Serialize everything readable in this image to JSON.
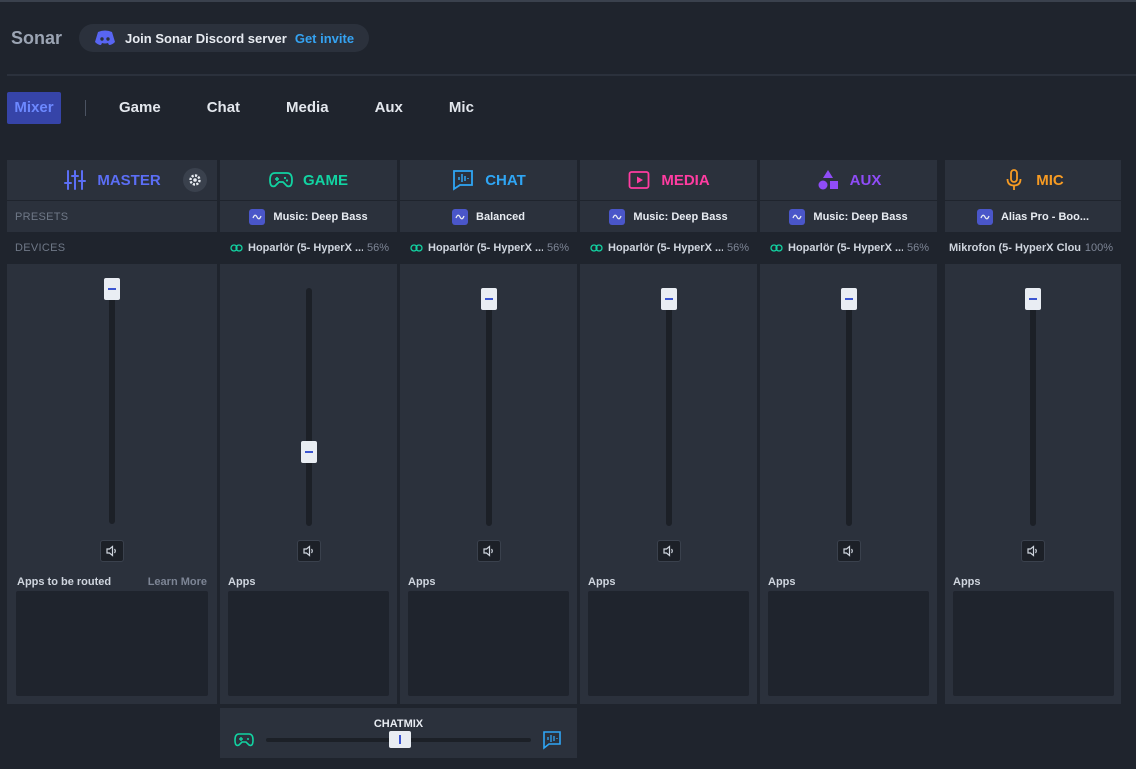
{
  "app": {
    "title": "Sonar",
    "discord_text": "Join Sonar Discord server",
    "discord_link": "Get invite"
  },
  "tabs": [
    "Mixer",
    "Game",
    "Chat",
    "Media",
    "Aux",
    "Mic"
  ],
  "labels": {
    "presets": "PRESETS",
    "devices": "DEVICES"
  },
  "master": {
    "title": "MASTER",
    "color": "#5b6ef5",
    "volume": 1.0,
    "apps_label": "Apps to be routed",
    "learn_more": "Learn More"
  },
  "channels": [
    {
      "key": "game",
      "title": "GAME",
      "color": "#12d3a2",
      "icon": "gamepad-icon",
      "preset": "Music: Deep Bass",
      "device": "Hoparlör (5- HyperX ...",
      "percent": "56%",
      "volume": 0.3,
      "apps_label": "Apps"
    },
    {
      "key": "chat",
      "title": "CHAT",
      "color": "#2fa6f5",
      "icon": "chat-wave-icon",
      "preset": "Balanced",
      "device": "Hoparlör (5- HyperX ...",
      "percent": "56%",
      "volume": 1.0,
      "apps_label": "Apps"
    },
    {
      "key": "media",
      "title": "MEDIA",
      "color": "#ff3ca1",
      "icon": "play-icon",
      "preset": "Music: Deep Bass",
      "device": "Hoparlör (5- HyperX ...",
      "percent": "56%",
      "volume": 1.0,
      "apps_label": "Apps"
    },
    {
      "key": "aux",
      "title": "AUX",
      "color": "#8f4cf7",
      "icon": "shapes-icon",
      "preset": "Music: Deep Bass",
      "device": "Hoparlör (5- HyperX ...",
      "percent": "56%",
      "volume": 1.0,
      "apps_label": "Apps"
    },
    {
      "key": "mic",
      "title": "MIC",
      "color": "#f79b23",
      "icon": "microphone-icon",
      "preset": "Alias Pro - Boo...",
      "device": "Mikrofon (5- HyperX Clou...",
      "percent": "100%",
      "volume": 1.0,
      "apps_label": "Apps"
    }
  ],
  "chatmix": {
    "label": "CHATMIX",
    "balance": 0.5
  }
}
